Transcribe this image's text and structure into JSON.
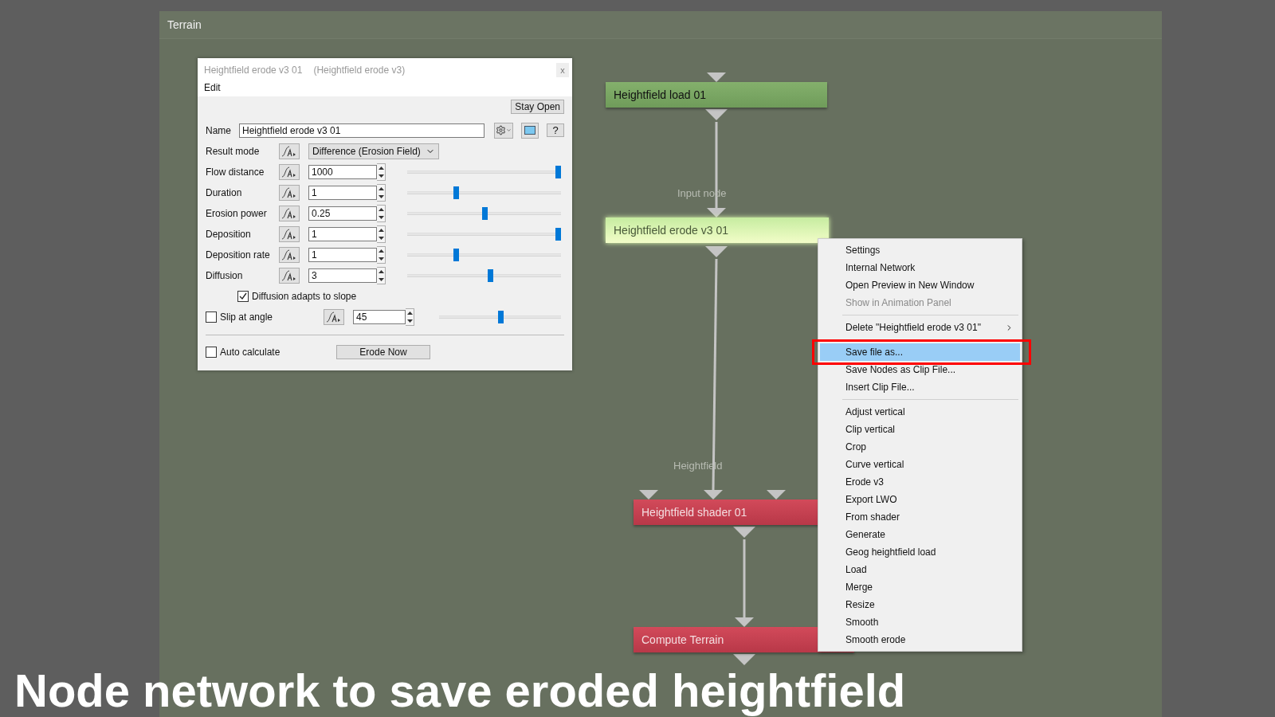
{
  "window": {
    "title": "Terrain"
  },
  "dialog": {
    "title": "Heightfield erode v3 01",
    "subtitle": "(Heightfield erode v3)",
    "close": "x",
    "menu": [
      "Edit"
    ],
    "stay_open": "Stay Open",
    "name_label": "Name",
    "name_value": "Heightfield erode v3 01",
    "help": "?",
    "result_mode": {
      "label": "Result mode",
      "value": "Difference (Erosion Field)"
    },
    "params": [
      {
        "label": "Flow distance",
        "value": "1000",
        "level": 1.0
      },
      {
        "label": "Duration",
        "value": "1",
        "level": 0.31
      },
      {
        "label": "Erosion power",
        "value": "0.25",
        "level": 0.5
      },
      {
        "label": "Deposition",
        "value": "1",
        "level": 1.0
      },
      {
        "label": "Deposition rate",
        "value": "1",
        "level": 0.31
      },
      {
        "label": "Diffusion",
        "value": "3",
        "level": 0.54
      }
    ],
    "diffusion_adapts": {
      "label": "Diffusion adapts to slope",
      "checked": true
    },
    "slip": {
      "label": "Slip at angle",
      "checked": false,
      "value": "45",
      "level": 0.5
    },
    "auto_calculate": {
      "label": "Auto calculate",
      "checked": false
    },
    "erode_button": "Erode Now"
  },
  "nodes": [
    {
      "label": "Heightfield load 01",
      "kind": "loader"
    },
    {
      "label": "Heightfield erode v3 01",
      "kind": "selected"
    },
    {
      "label": "Heightfield shader 01",
      "kind": "shader"
    },
    {
      "label": "Compute Terrain",
      "kind": "shader"
    }
  ],
  "connection_labels": [
    "Input node",
    "Heightfield"
  ],
  "context_menu": {
    "groups": [
      [
        {
          "label": "Settings",
          "disabled": false,
          "selected": false,
          "submenu": false
        },
        {
          "label": "Internal Network",
          "disabled": false,
          "selected": false,
          "submenu": false
        },
        {
          "label": "Open Preview in New Window",
          "disabled": false,
          "selected": false,
          "submenu": false
        },
        {
          "label": "Show in Animation Panel",
          "disabled": true,
          "selected": false,
          "submenu": false
        }
      ],
      [
        {
          "label": "Delete \"Heightfield erode v3 01\"",
          "disabled": false,
          "selected": false,
          "submenu": true
        }
      ],
      [
        {
          "label": "Save file as...",
          "disabled": false,
          "selected": true,
          "submenu": false
        },
        {
          "label": "Save Nodes as Clip File...",
          "disabled": false,
          "selected": false,
          "submenu": false
        },
        {
          "label": "Insert Clip File...",
          "disabled": false,
          "selected": false,
          "submenu": false
        }
      ],
      [
        {
          "label": "Adjust vertical",
          "disabled": false,
          "selected": false,
          "submenu": false
        },
        {
          "label": "Clip vertical",
          "disabled": false,
          "selected": false,
          "submenu": false
        },
        {
          "label": "Crop",
          "disabled": false,
          "selected": false,
          "submenu": false
        },
        {
          "label": "Curve vertical",
          "disabled": false,
          "selected": false,
          "submenu": false
        },
        {
          "label": "Erode v3",
          "disabled": false,
          "selected": false,
          "submenu": false
        },
        {
          "label": "Export LWO",
          "disabled": false,
          "selected": false,
          "submenu": false
        },
        {
          "label": "From shader",
          "disabled": false,
          "selected": false,
          "submenu": false
        },
        {
          "label": "Generate",
          "disabled": false,
          "selected": false,
          "submenu": false
        },
        {
          "label": "Geog heightfield load",
          "disabled": false,
          "selected": false,
          "submenu": false
        },
        {
          "label": "Load",
          "disabled": false,
          "selected": false,
          "submenu": false
        },
        {
          "label": "Merge",
          "disabled": false,
          "selected": false,
          "submenu": false
        },
        {
          "label": "Resize",
          "disabled": false,
          "selected": false,
          "submenu": false
        },
        {
          "label": "Smooth",
          "disabled": false,
          "selected": false,
          "submenu": false
        },
        {
          "label": "Smooth erode",
          "disabled": false,
          "selected": false,
          "submenu": false
        }
      ]
    ]
  },
  "caption": "Node network to save eroded heightfield"
}
